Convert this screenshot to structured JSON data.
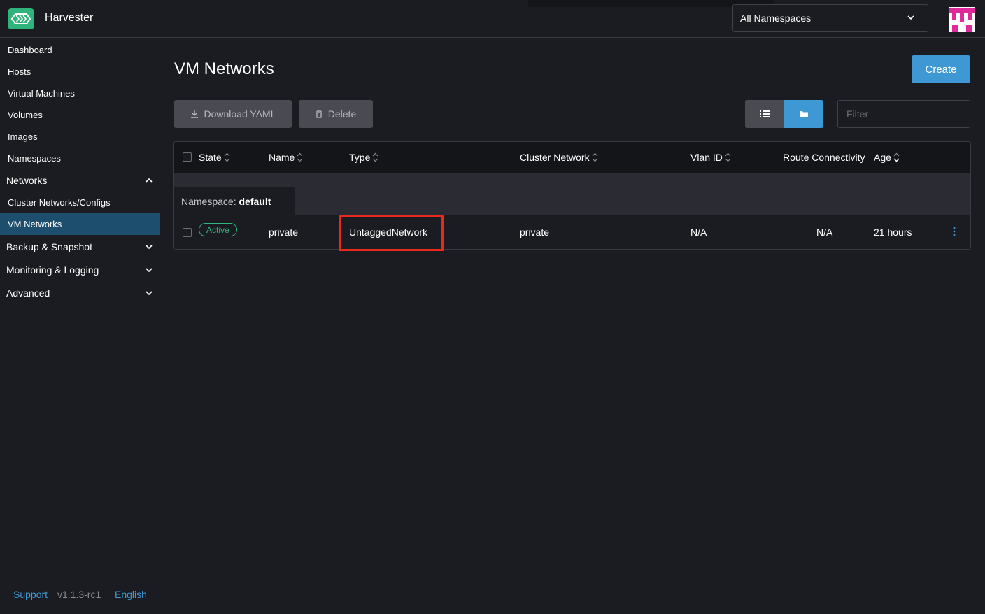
{
  "header": {
    "app_title": "Harvester",
    "namespace_select": "All Namespaces",
    "brand_color": "#2fb47c"
  },
  "sidebar": {
    "items": [
      {
        "label": "Dashboard"
      },
      {
        "label": "Hosts"
      },
      {
        "label": "Virtual Machines"
      },
      {
        "label": "Volumes"
      },
      {
        "label": "Images"
      },
      {
        "label": "Namespaces"
      }
    ],
    "groups": {
      "networks": "Networks",
      "cluster_networks": "Cluster Networks/Configs",
      "vm_networks": "VM Networks",
      "backup": "Backup & Snapshot",
      "monitoring": "Monitoring & Logging",
      "advanced": "Advanced"
    },
    "footer": {
      "support": "Support",
      "version": "v1.1.3-rc1",
      "language": "English"
    }
  },
  "main": {
    "title": "VM Networks",
    "create_label": "Create",
    "download_label": "Download YAML",
    "delete_label": "Delete",
    "filter_placeholder": "Filter"
  },
  "table": {
    "columns": [
      "State",
      "Name",
      "Type",
      "Cluster Network",
      "Vlan ID",
      "Route Connectivity",
      "Age"
    ],
    "group_prefix": "Namespace:",
    "group_name": "default",
    "rows": [
      {
        "state": "Active",
        "name": "private",
        "type": "UntaggedNetwork",
        "cluster_network": "private",
        "vlan_id": "N/A",
        "route_connectivity": "N/A",
        "age": "21 hours"
      }
    ]
  },
  "colors": {
    "accent": "#3d98d3",
    "active": "#2fb47c",
    "highlight": "#e8291c"
  }
}
